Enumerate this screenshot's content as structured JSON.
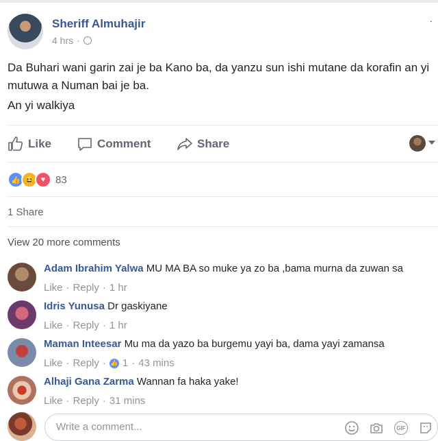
{
  "post": {
    "author": "Sheriff Almuhajir",
    "time": "4 hrs",
    "separator": "·",
    "text": "Da Buhari wani garin zai je ba Kano ba, da yanzu sun ishi mutane da korafin an yi mutuwa a Numan bai je ba.",
    "text2": "An yi walkiya"
  },
  "actions": {
    "like": "Like",
    "comment": "Comment",
    "share": "Share"
  },
  "reactions": {
    "count": "83",
    "types": [
      "like",
      "haha",
      "love"
    ]
  },
  "shares": "1 Share",
  "view_more": "View 20 more comments",
  "comments": [
    {
      "name": "Adam Ibrahim Yalwa",
      "text": "MU MA BA so muke ya zo ba ,bama murna da zuwan sa",
      "like": "Like",
      "reply": "Reply",
      "time": "1 hr",
      "likes": ""
    },
    {
      "name": "Idris Yunusa",
      "text": "Dr gaskiyane",
      "like": "Like",
      "reply": "Reply",
      "time": "1 hr",
      "likes": ""
    },
    {
      "name": "Maman Inteesar",
      "text": "Mu ma da yazo ba burgemu yayi ba, dama yayi zamansa",
      "like": "Like",
      "reply": "Reply",
      "time": "43 mins",
      "likes": "1"
    },
    {
      "name": "Alhaji Gana Zarma",
      "text": "Wannan fa haka yake!",
      "like": "Like",
      "reply": "Reply",
      "time": "31 mins",
      "likes": ""
    }
  ],
  "composer": {
    "placeholder": "Write a comment..."
  },
  "colors": {
    "link": "#365899",
    "muted": "#90949c",
    "like_blue": "#5890ff",
    "love_red": "#f25268",
    "haha_yellow": "#f7b125"
  }
}
